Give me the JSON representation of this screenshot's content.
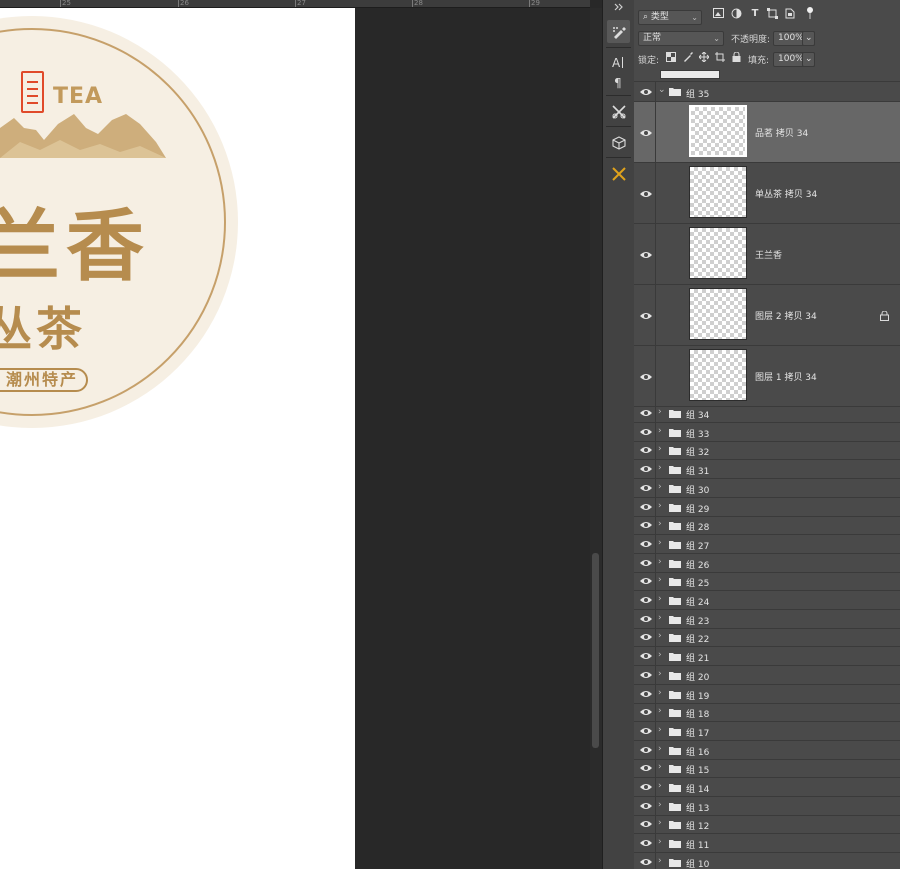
{
  "ruler": {
    "ticks": [
      "25",
      "26",
      "27",
      "28",
      "29"
    ]
  },
  "artwork": {
    "brand_text": "TEA",
    "title_line1": "兰香",
    "title_line2": "丛茶",
    "origin_label": "潮州特产",
    "colors": {
      "gold": "#b68c4e",
      "seal_red": "#e04a2a",
      "badge_bg": "#f6efe3"
    }
  },
  "layers_panel": {
    "filter": {
      "label": "类型"
    },
    "blend_mode": {
      "value": "正常"
    },
    "opacity": {
      "label": "不透明度:",
      "value": "100%"
    },
    "lock": {
      "label": "锁定:"
    },
    "fill": {
      "label": "填充:",
      "value": "100%"
    },
    "open_group": {
      "name": "组 35"
    },
    "child_layers": [
      {
        "name": "品茗 拷贝 34",
        "selected": true,
        "locked": false
      },
      {
        "name": "单丛茶 拷贝 34",
        "selected": false,
        "locked": false
      },
      {
        "name": "王兰香",
        "selected": false,
        "locked": false
      },
      {
        "name": "图层 2 拷贝 34",
        "selected": false,
        "locked": true
      },
      {
        "name": "图层 1 拷贝 34",
        "selected": false,
        "locked": false
      }
    ],
    "collapsed_groups": [
      "组 34",
      "组 33",
      "组 32",
      "组 31",
      "组 30",
      "组 29",
      "组 28",
      "组 27",
      "组 26",
      "组 25",
      "组 24",
      "组 23",
      "组 22",
      "组 21",
      "组 20",
      "组 19",
      "组 18",
      "组 17",
      "组 16",
      "组 15",
      "组 14",
      "组 13",
      "组 12",
      "组 11",
      "组 10"
    ]
  }
}
